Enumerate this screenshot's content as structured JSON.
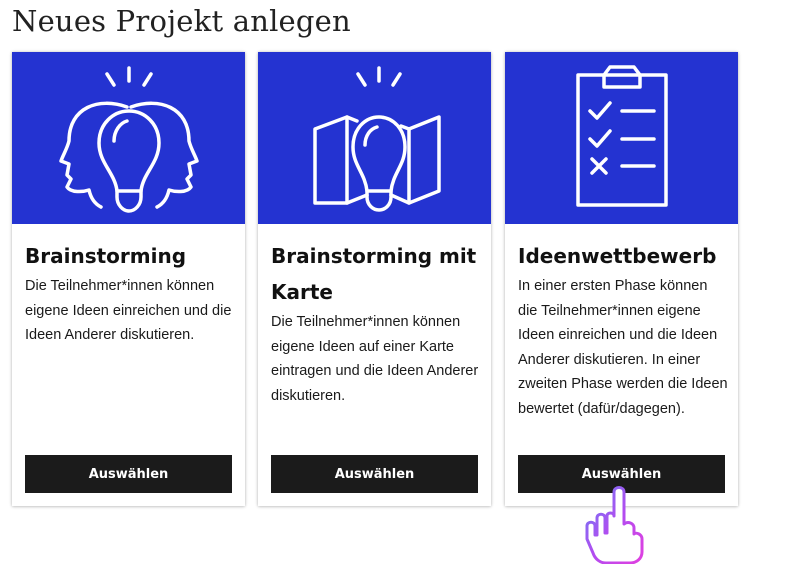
{
  "page": {
    "title": "Neues Projekt anlegen"
  },
  "cards": [
    {
      "title": "Brainstorming",
      "description": "Die Teilnehmer*innen können eigene Ideen einreichen und die Ideen Anderer diskutieren.",
      "button_label": "Auswählen",
      "icon": "heads-lightbulb-icon"
    },
    {
      "title": "Brainstorming mit Karte",
      "description": "Die Teilnehmer*innen können eigene Ideen auf einer Karte eintragen und die Ideen Anderer diskutieren.",
      "button_label": "Auswählen",
      "icon": "map-lightbulb-icon"
    },
    {
      "title": "Ideenwettbewerb",
      "description": "In einer ersten Phase können die Teilnehmer*innen eigene Ideen einreichen und die Ideen Anderer diskutieren. In einer zweiten Phase werden die Ideen bewertet (dafür/dagegen).",
      "button_label": "Auswählen",
      "icon": "clipboard-checklist-icon"
    }
  ],
  "colors": {
    "card_image_bg": "#2433d1",
    "button_bg": "#1b1b1b",
    "cursor_accent": "#a23cf0"
  },
  "cursor": {
    "icon": "hand-pointer-icon"
  }
}
